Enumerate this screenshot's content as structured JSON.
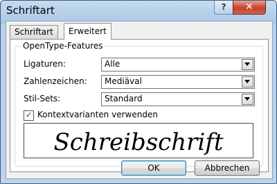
{
  "window": {
    "title": "Schriftart",
    "help_label": "?",
    "close_label": "✕"
  },
  "tabs": [
    {
      "label": "Schriftart",
      "active": false
    },
    {
      "label": "Erweitert",
      "active": true
    }
  ],
  "group": {
    "title": "OpenType-Features",
    "rows": [
      {
        "label": "Ligaturen:",
        "value": "Alle"
      },
      {
        "label": "Zahlenzeichen:",
        "value": "Mediäval"
      },
      {
        "label": "Stil-Sets:",
        "value": "Standard"
      }
    ],
    "checkbox": {
      "label": "Kontextvarianten verwenden",
      "checked": true,
      "mark": "✓"
    },
    "preview_text": "Schreibschrift"
  },
  "buttons": {
    "ok": "OK",
    "cancel": "Abbrechen"
  }
}
